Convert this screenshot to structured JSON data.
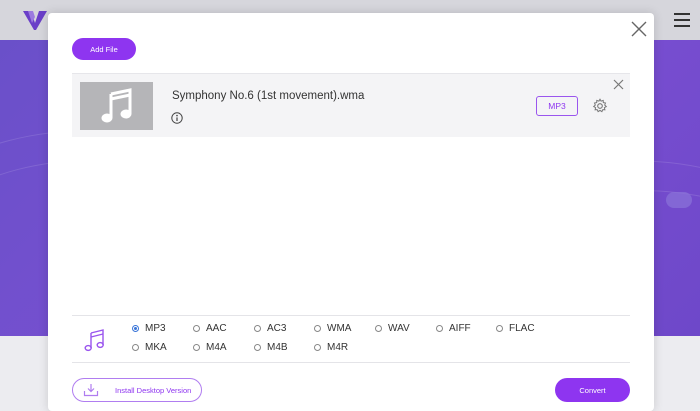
{
  "modal": {
    "add_file_label": "Add File",
    "file": {
      "name": "Symphony No.6 (1st movement).wma",
      "output_format": "MP3"
    },
    "formats": [
      {
        "label": "MP3",
        "checked": true
      },
      {
        "label": "AAC",
        "checked": false
      },
      {
        "label": "AC3",
        "checked": false
      },
      {
        "label": "WMA",
        "checked": false
      },
      {
        "label": "WAV",
        "checked": false
      },
      {
        "label": "AIFF",
        "checked": false
      },
      {
        "label": "FLAC",
        "checked": false
      },
      {
        "label": "MKA",
        "checked": false
      },
      {
        "label": "M4A",
        "checked": false
      },
      {
        "label": "M4B",
        "checked": false
      },
      {
        "label": "M4R",
        "checked": false
      }
    ],
    "install_label": "Install Desktop Version",
    "convert_label": "Convert"
  },
  "colors": {
    "accent": "#8e35f0",
    "background_purple": "#6a50c9",
    "thumbnail_gray": "#b5b5b8"
  },
  "icons": [
    "logo-icon",
    "hamburger-menu-icon",
    "close-icon",
    "music-note-icon",
    "info-icon",
    "gear-icon",
    "remove-icon",
    "music-icon",
    "download-icon"
  ]
}
